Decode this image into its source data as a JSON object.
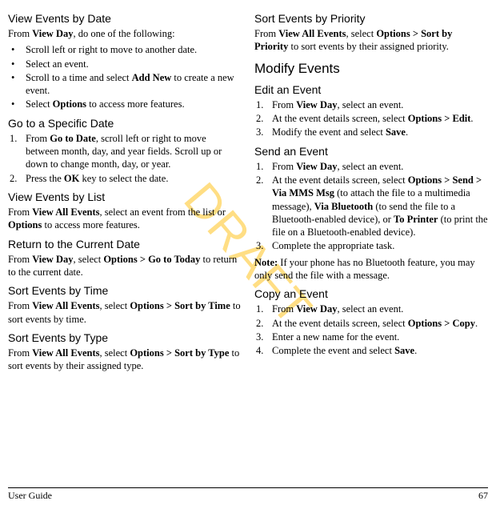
{
  "watermark": "DRAFT",
  "footer": {
    "left": "User Guide",
    "right": "67"
  },
  "left": {
    "h1": "View Events by Date",
    "p1_prefix": "From ",
    "p1_bold": "View Day",
    "p1_suffix": ", do one of the following:",
    "b1": "Scroll left or right to move to another date.",
    "b2": "Select an event.",
    "b3_prefix": "Scroll to a time and select ",
    "b3_bold": "Add New",
    "b3_suffix": " to create a new event.",
    "b4_prefix": "Select ",
    "b4_bold": "Options",
    "b4_suffix": " to access more features.",
    "h2": "Go to a Specific Date",
    "n1_prefix": "From ",
    "n1_bold": "Go to Date",
    "n1_suffix": ", scroll left or right to move between month, day, and year fields. Scroll up or down to change month, day, or year.",
    "n2_prefix": "Press the ",
    "n2_bold": "OK",
    "n2_suffix": " key to select the date.",
    "h3": "View Events by List",
    "p3_prefix": "From ",
    "p3_bold1": "View All Events",
    "p3_mid": ", select an event from the list or ",
    "p3_bold2": "Options",
    "p3_suffix": " to access more features.",
    "h4": "Return to the Current Date",
    "p4_prefix": "From ",
    "p4_bold1": "View Day",
    "p4_mid1": ", select ",
    "p4_bold2": "Options > Go to Today",
    "p4_suffix": " to return to the current date.",
    "h5": "Sort Events by Time",
    "p5_prefix": "From ",
    "p5_bold1": "View All Events",
    "p5_mid": ", select ",
    "p5_bold2": "Options > Sort by Time",
    "p5_suffix": " to sort events by time.",
    "h6": "Sort Events by Type",
    "p6_prefix": "From ",
    "p6_bold1": "View All Events",
    "p6_mid": ", select ",
    "p6_bold2": "Options > Sort by Type",
    "p6_suffix": " to sort events by their assigned type."
  },
  "right": {
    "h1": "Sort Events by Priority",
    "p1_prefix": "From ",
    "p1_bold1": "View All Events",
    "p1_mid": ", select ",
    "p1_bold2": "Options > Sort by Priority",
    "p1_suffix": " to sort events by their assigned priority.",
    "h2": "Modify Events",
    "h3": "Edit an Event",
    "e1_prefix": "From ",
    "e1_bold": "View Day",
    "e1_suffix": ", select an event.",
    "e2_prefix": "At the event details screen, select ",
    "e2_bold": "Options > Edit",
    "e2_suffix": ".",
    "e3_prefix": "Modify the event and select ",
    "e3_bold": "Save",
    "e3_suffix": ".",
    "h4": "Send an Event",
    "s1_prefix": "From ",
    "s1_bold": "View Day",
    "s1_suffix": ", select an event.",
    "s2_prefix": "At the event details screen, select ",
    "s2_bold1": "Options > Send > Via MMS Msg",
    "s2_mid1": " (to attach the file to a multimedia message), ",
    "s2_bold2": "Via Bluetooth",
    "s2_mid2": " (to send the file to a Bluetooth-enabled device), or ",
    "s2_bold3": "To Printer",
    "s2_suffix": " (to print the file on a Bluetooth-enabled device).",
    "s3": "Complete the appropriate task.",
    "note_bold": "Note:",
    "note_text": " If your phone has no Bluetooth feature, you may only send the file with a message.",
    "h5": "Copy an Event",
    "c1_prefix": "From ",
    "c1_bold": "View Day",
    "c1_suffix": ", select an event.",
    "c2_prefix": "At the event details screen, select ",
    "c2_bold": "Options > Copy",
    "c2_suffix": ".",
    "c3": "Enter a new name for the event.",
    "c4_prefix": "Complete the event and select ",
    "c4_bold": "Save",
    "c4_suffix": "."
  }
}
